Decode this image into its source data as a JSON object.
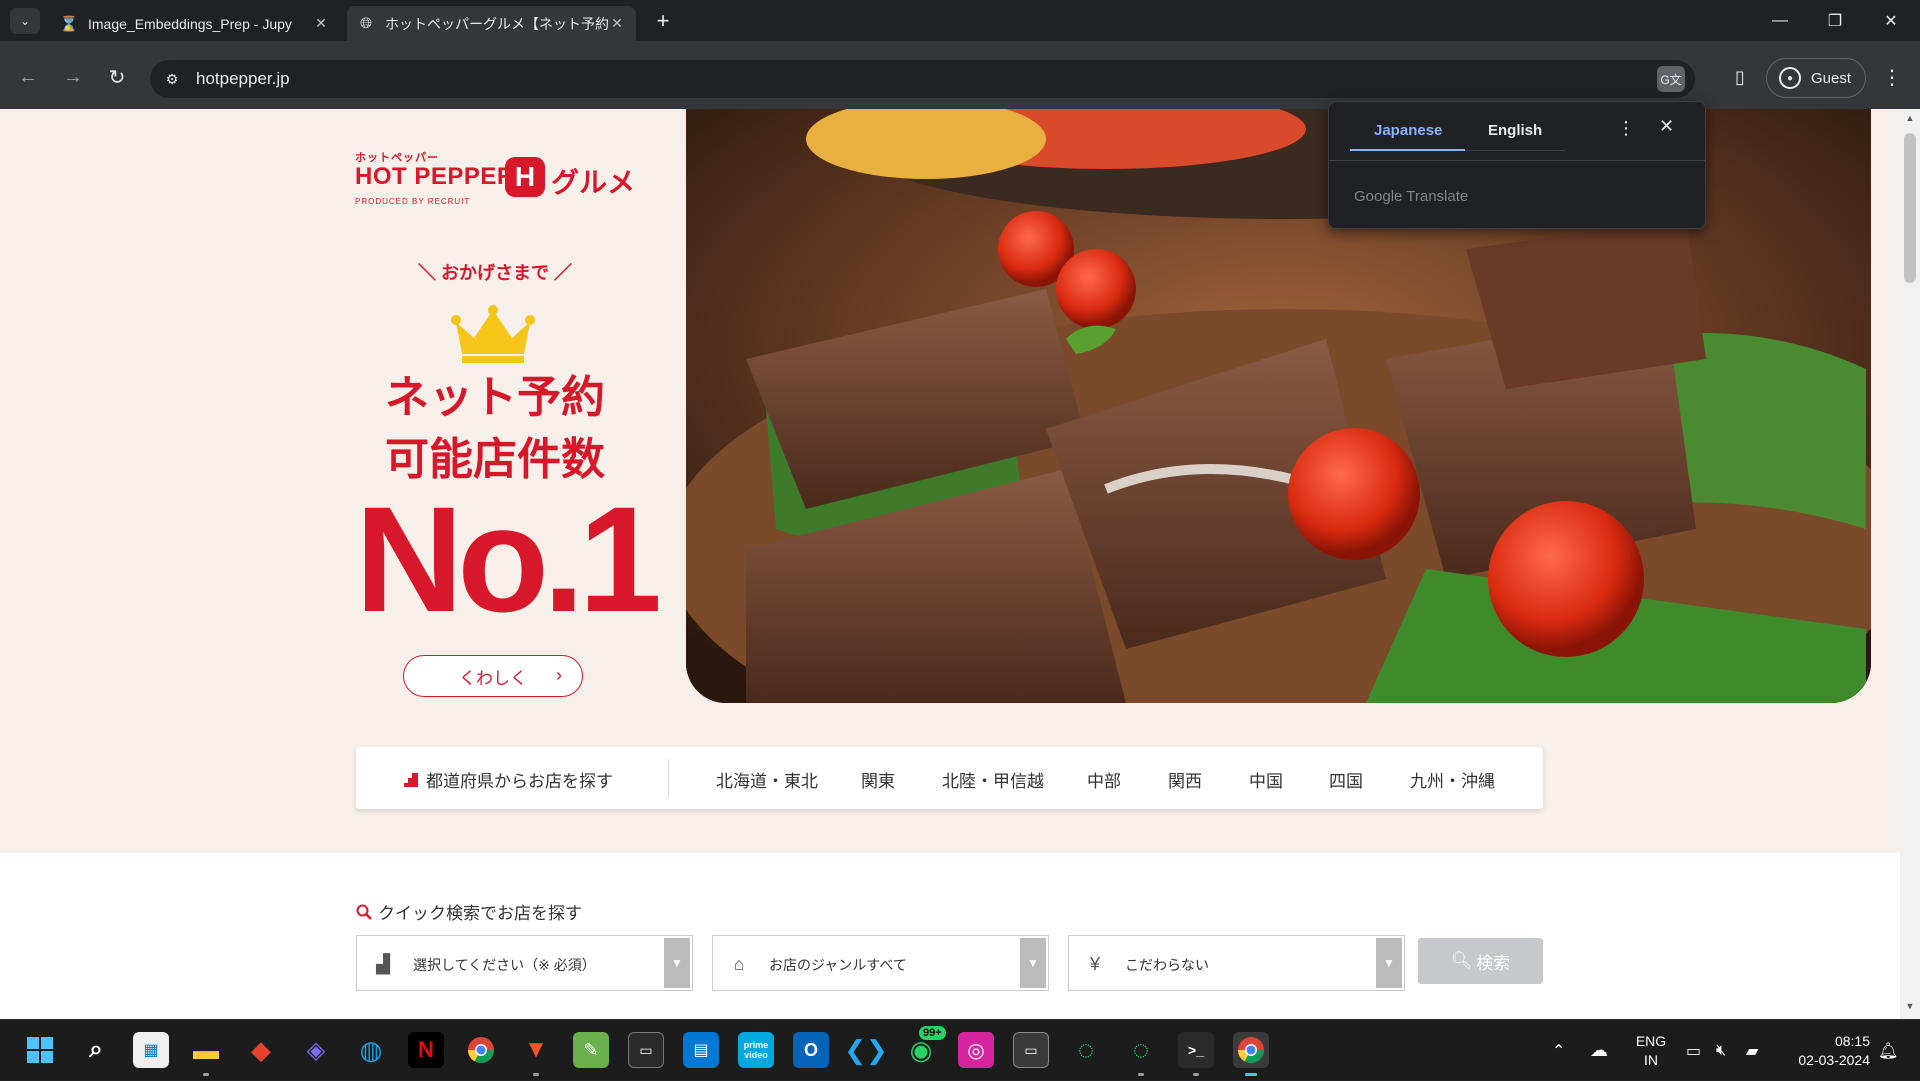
{
  "browser": {
    "tabs": [
      {
        "title": "Image_Embeddings_Prep - Jupy",
        "favicon": "hourglass-icon",
        "active": false
      },
      {
        "title": "ホットペッパーグルメ【ネット予約可能",
        "favicon": "globe-icon",
        "active": true
      }
    ],
    "url": "hotpepper.jp",
    "profile_label": "Guest"
  },
  "translate_popup": {
    "source_lang": "Japanese",
    "target_lang": "English",
    "provider": "Google Translate"
  },
  "logo": {
    "kana_small": "ホットペッパー",
    "brand": "HOT PEPPER",
    "mark": "H",
    "gourmet": "グルメ",
    "produced_by": "PRODUCED BY RECRUIT"
  },
  "hero": {
    "tagline": "＼ おかげさまで ／",
    "headline_line1": "ネット予約",
    "headline_line2": "可能店件数",
    "rank": "No.1",
    "detail_button": "くわしく",
    "image_alt": "grilled-steak-with-tomatoes-and-greens"
  },
  "region_search": {
    "label": "都道府県からお店を探す",
    "regions": [
      "北海道・東北",
      "関東",
      "北陸・甲信越",
      "中部",
      "関西",
      "中国",
      "四国",
      "九州・沖縄"
    ]
  },
  "quick_search": {
    "title": "クイック検索でお店を探す",
    "area_placeholder": "選択してください（※ 必須）",
    "genre_value": "お店のジャンルすべて",
    "budget_value": "こだわらない",
    "search_button": "検索"
  },
  "taskbar": {
    "language_line1": "ENG",
    "language_line2": "IN",
    "time": "08:15",
    "date": "02-03-2024",
    "whatsapp_badge": "99+"
  },
  "colors": {
    "brand_red": "#d7182a",
    "hero_bg": "#f7efe9",
    "chrome_dark": "#202124",
    "accent_blue": "#8ab4f8"
  }
}
